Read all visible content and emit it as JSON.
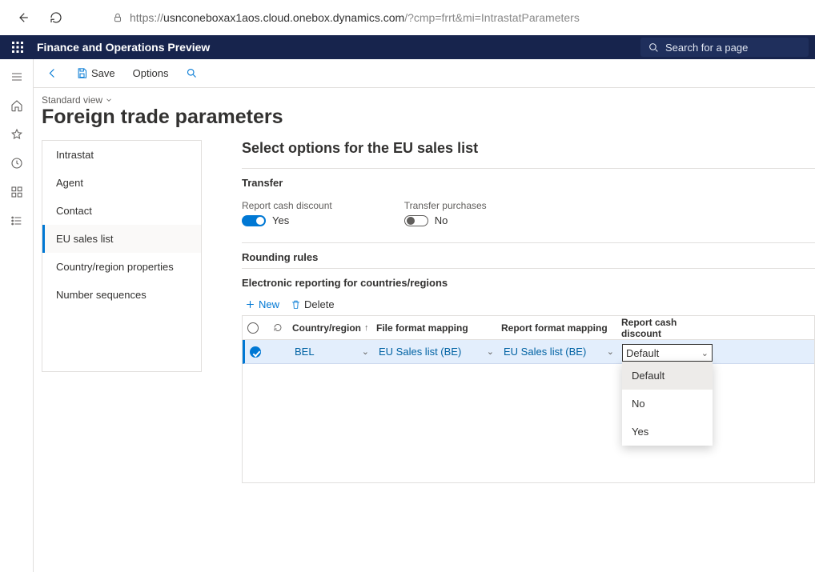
{
  "browser": {
    "url_scheme": "https://",
    "url_host": "usnconeboxax1aos.cloud.onebox.dynamics.com",
    "url_path": "/?cmp=frrt&mi=IntrastatParameters"
  },
  "shell": {
    "app_title": "Finance and Operations Preview",
    "search_placeholder": "Search for a page"
  },
  "actions": {
    "save": "Save",
    "options": "Options"
  },
  "page": {
    "view_label": "Standard view",
    "title": "Foreign trade parameters"
  },
  "side_nav": {
    "items": [
      "Intrastat",
      "Agent",
      "Contact",
      "EU sales list",
      "Country/region properties",
      "Number sequences"
    ],
    "active_index": 3
  },
  "main": {
    "heading": "Select options for the EU sales list",
    "sections": {
      "transfer": {
        "title": "Transfer",
        "report_cash_discount_label": "Report cash discount",
        "report_cash_discount_value": "Yes",
        "transfer_purchases_label": "Transfer purchases",
        "transfer_purchases_value": "No"
      },
      "rounding": {
        "title": "Rounding rules"
      },
      "er": {
        "title": "Electronic reporting for countries/regions",
        "new_btn": "New",
        "delete_btn": "Delete",
        "columns": {
          "country": "Country/region",
          "ffm": "File format mapping",
          "rfm": "Report format mapping",
          "rcd": "Report cash discount"
        },
        "row": {
          "country": "BEL",
          "ffm": "EU Sales list (BE)",
          "rfm": "EU Sales list (BE)",
          "rcd": "Default"
        },
        "dropdown_options": [
          "Default",
          "No",
          "Yes"
        ]
      }
    }
  }
}
